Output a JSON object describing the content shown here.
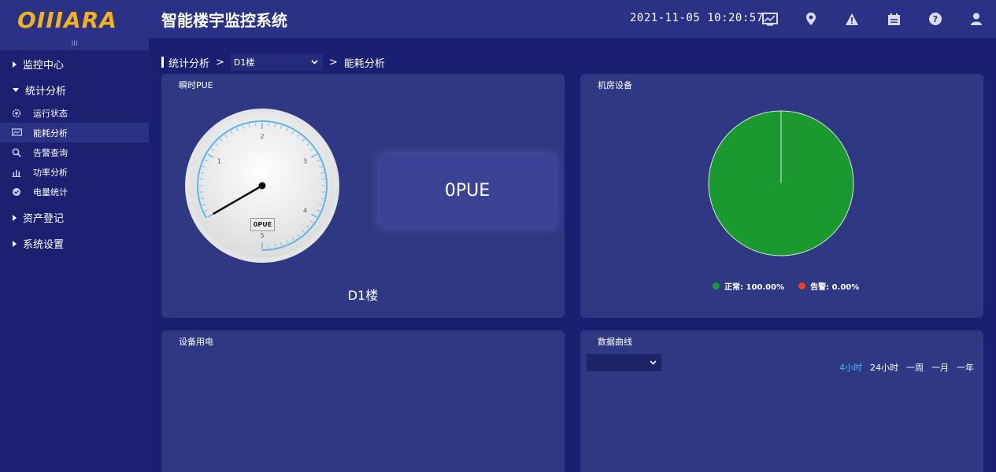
{
  "header": {
    "logo": "OIIIARA",
    "title": "智能楼宇监控系统",
    "datetime": "2021-11-05 10:20:57",
    "icons": [
      "chart-monitor-icon",
      "location-pin-icon",
      "alert-triangle-icon",
      "calendar-icon",
      "help-icon",
      "user-icon"
    ]
  },
  "sidebar": {
    "collapse_glyph": "III",
    "groups": [
      {
        "label": "监控中心",
        "expanded": false
      },
      {
        "label": "统计分析",
        "expanded": true
      },
      {
        "label": "资产登记",
        "expanded": false
      },
      {
        "label": "系统设置",
        "expanded": false
      }
    ],
    "sub_items": [
      {
        "label": "运行状态",
        "icon": "gear-icon",
        "active": false
      },
      {
        "label": "能耗分析",
        "icon": "monitor-icon",
        "active": true
      },
      {
        "label": "告警查询",
        "icon": "search-icon",
        "active": false
      },
      {
        "label": "功率分析",
        "icon": "bar-chart-icon",
        "active": false
      },
      {
        "label": "电量统计",
        "icon": "check-circle-icon",
        "active": false
      }
    ]
  },
  "breadcrumb": {
    "root": "统计分析",
    "separator": ">",
    "building_select": "D1楼",
    "current": "能耗分析"
  },
  "panels": {
    "pue": {
      "title": "瞬时PUE",
      "gauge_label": "0PUE",
      "gauge_ticks": [
        "1",
        "2",
        "3",
        "4",
        "5"
      ],
      "gauge_value": 0,
      "value_text": "0PUE",
      "building": "D1楼"
    },
    "room": {
      "title": "机房设备",
      "legend": [
        {
          "label": "正常: 100.00%",
          "color": "#1a9a2e"
        },
        {
          "label": "告警: 0.00%",
          "color": "#e8402a"
        }
      ]
    },
    "device_power": {
      "title": "设备用电"
    },
    "curve": {
      "title": "数据曲线",
      "select_value": "",
      "ranges": [
        "4小时",
        "24小时",
        "一周",
        "一月",
        "一年"
      ],
      "active_range": "4小时"
    }
  },
  "colors": {
    "bg": "#1b1f72",
    "header": "#2b3285",
    "panel": "#2f3883",
    "logo": "#f2b220",
    "pie_normal": "#1a9a2e",
    "accent": "#4fb3ff"
  }
}
